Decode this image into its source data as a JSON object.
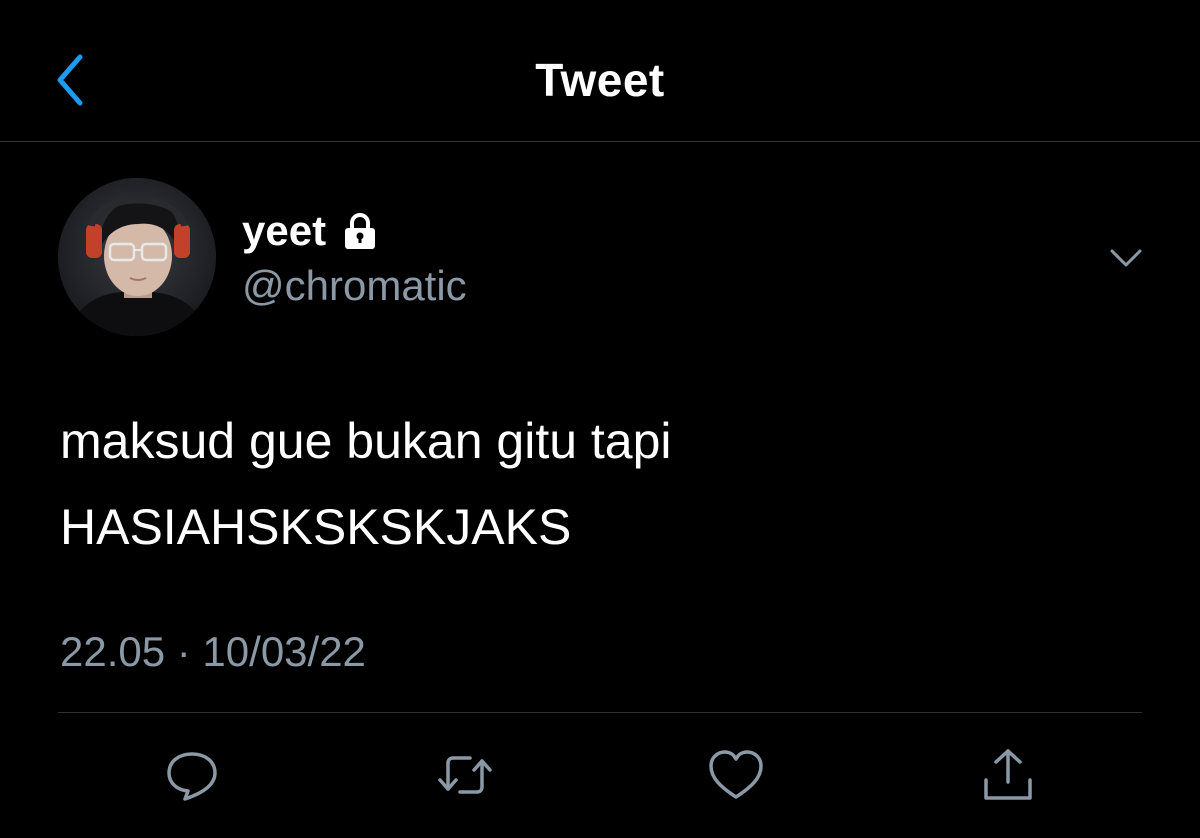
{
  "nav": {
    "title": "Tweet",
    "back_icon": "chevron-left-icon"
  },
  "colors": {
    "background": "#000000",
    "accent": "#1d9bf0",
    "secondary_text": "#8b98a5",
    "divider": "#2f3336",
    "text": "#ffffff"
  },
  "author": {
    "display_name": "yeet",
    "handle": "@chromatic",
    "protected_icon": "lock-icon",
    "avatar": "profile-photo"
  },
  "tweet": {
    "lines": [
      "maksud gue bukan gitu tapi",
      "HASIAHSKSKSKJAKS"
    ],
    "timestamp": "22.05 · 10/03/22"
  },
  "actions": [
    {
      "name": "reply",
      "icon": "speech-bubble-icon"
    },
    {
      "name": "retweet",
      "icon": "retweet-icon"
    },
    {
      "name": "like",
      "icon": "heart-icon"
    },
    {
      "name": "share",
      "icon": "share-icon"
    }
  ],
  "menu_icon": "chevron-down-icon"
}
